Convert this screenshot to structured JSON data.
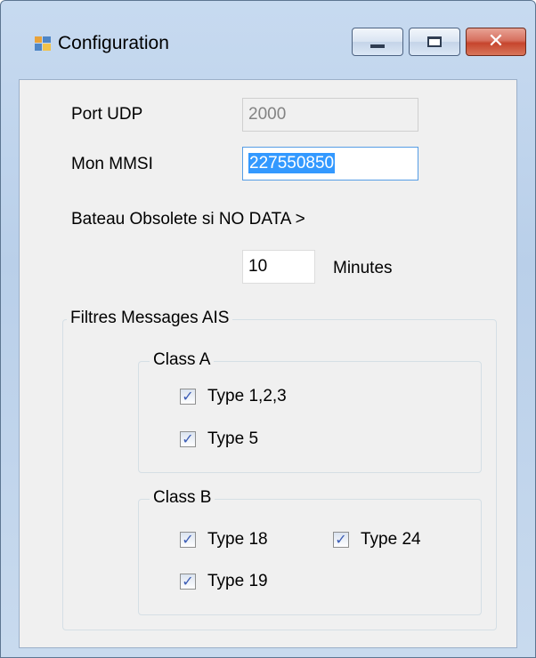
{
  "window": {
    "title": "Configuration",
    "app_icon": "form-icon",
    "buttons": {
      "minimize": "minimize-icon",
      "maximize": "maximize-icon",
      "close": "close-icon"
    }
  },
  "form": {
    "port_udp": {
      "label": "Port UDP",
      "value": "2000",
      "enabled": false
    },
    "mmsi": {
      "label": "Mon MMSI",
      "value": "227550850",
      "selected": true
    },
    "obsolete": {
      "label": "Bateau Obsolete si NO DATA >",
      "value": "10",
      "unit": "Minutes"
    }
  },
  "filters": {
    "legend": "Filtres Messages AIS",
    "class_a": {
      "legend": "Class A",
      "items": [
        {
          "label": "Type 1,2,3",
          "checked": true
        },
        {
          "label": "Type 5",
          "checked": true
        }
      ]
    },
    "class_b": {
      "legend": "Class B",
      "items": [
        {
          "label": "Type 18",
          "checked": true
        },
        {
          "label": "Type 24",
          "checked": true
        },
        {
          "label": "Type 19",
          "checked": true
        }
      ]
    }
  },
  "check_glyph": "✓",
  "colors": {
    "frame": "#b9cfe9",
    "client": "#f0f0f0",
    "selection": "#3399ff",
    "close_button": "#c6452d",
    "check": "#3b5cb5"
  }
}
